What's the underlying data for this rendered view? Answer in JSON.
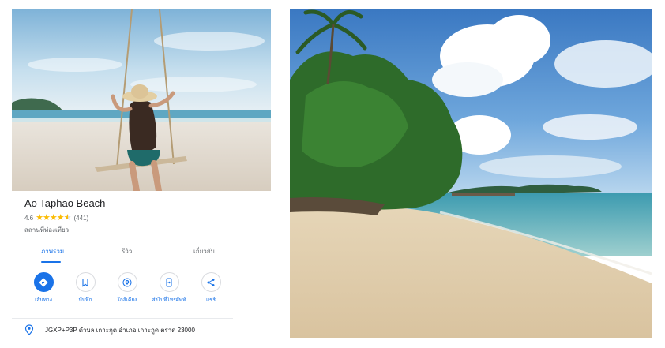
{
  "place": {
    "title": "Ao Taphao Beach",
    "rating": "4.6",
    "stars": 4.5,
    "reviews": "(441)",
    "category": "สถานที่ท่องเที่ยว"
  },
  "tabs": [
    {
      "label": "ภาพรวม",
      "active": true
    },
    {
      "label": "รีวิว",
      "active": false
    },
    {
      "label": "เกี่ยวกับ",
      "active": false
    }
  ],
  "actions": [
    {
      "label": "เส้นทาง",
      "icon": "directions-icon"
    },
    {
      "label": "บันทึก",
      "icon": "bookmark-icon"
    },
    {
      "label": "ใกล้เคียง",
      "icon": "nearby-icon"
    },
    {
      "label": "ส่งไปที่โทรศัพท์",
      "icon": "send-to-phone-icon"
    },
    {
      "label": "แชร์",
      "icon": "share-icon"
    }
  ],
  "address": {
    "text": "JGXP+P3P ตำบล เกาะกูด อำเภอ เกาะกูด ตราด 23000",
    "icon": "location-pin-icon"
  },
  "images": {
    "hero": "woman-on-beach-swing-photo",
    "side": "beach-with-tree-photo"
  },
  "colors": {
    "accent": "#1a73e8",
    "star": "#fbbc04"
  }
}
